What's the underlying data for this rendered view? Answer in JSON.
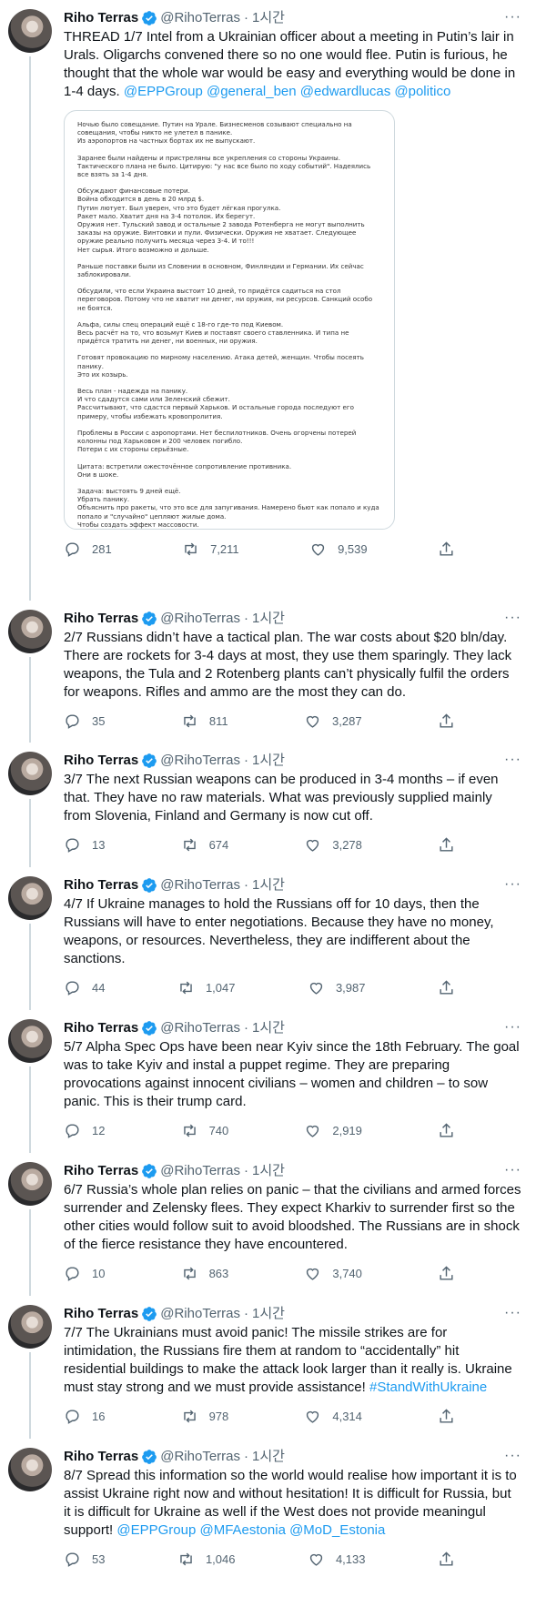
{
  "author": {
    "name": "Riho Terras",
    "handle": "@RihoTerras",
    "time": "1시간"
  },
  "colors": {
    "accent": "#1d9bf0",
    "text": "#0f1419",
    "muted": "#536471",
    "border": "#cfd9de"
  },
  "tweets": [
    {
      "text_parts": [
        "THREAD 1/7 Intel from a Ukrainian officer about a meeting in Putin’s lair in Urals. Oligarchs convened there so no one would flee. Putin is furious, he thought that the whole war would be easy and everything would be done in 1-4 days. "
      ],
      "mentions": "@EPPGroup @general_ben @edwardlucas @politico",
      "replies": "281",
      "retweets": "7,211",
      "likes": "9,539"
    },
    {
      "text": "2/7 Russians didn’t have a tactical plan. The war costs about $20 bln/day. There are rockets for 3-4 days at most, they use them sparingly. They lack weapons, the Tula and 2 Rotenberg plants can’t physically fulfil the orders for weapons. Rifles and ammo are the most they can do.",
      "replies": "35",
      "retweets": "811",
      "likes": "3,287"
    },
    {
      "text": "3/7 The next Russian weapons can be produced in 3-4 months – if even that. They have no raw materials. What was previously supplied mainly from Slovenia, Finland and Germany is now cut off.",
      "replies": "13",
      "retweets": "674",
      "likes": "3,278"
    },
    {
      "text": "4/7 If Ukraine manages to hold the Russians off for 10 days, then the Russians will have to enter negotiations. Because they have no money, weapons, or resources. Nevertheless, they are indifferent about the sanctions.",
      "replies": "44",
      "retweets": "1,047",
      "likes": "3,987"
    },
    {
      "text": "5/7 Alpha Spec Ops have been near Kyiv since the 18th February. The goal was to take Kyiv and instal a puppet regime. They are preparing provocations against innocent civilians – women and children – to sow panic. This is their trump card.",
      "replies": "12",
      "retweets": "740",
      "likes": "2,919"
    },
    {
      "text": "6/7 Russia’s whole plan relies on panic – that the civilians and armed forces surrender and Zelensky flees. They expect Kharkiv to surrender first so the other cities would follow suit to avoid bloodshed. The Russians are in shock of the fierce resistance they have encountered.",
      "replies": "10",
      "retweets": "863",
      "likes": "3,740"
    },
    {
      "text": "7/7 The Ukrainians must avoid panic! The missile strikes are for intimidation, the Russians fire them at random to “accidentally” hit residential buildings to make the attack look larger than it really is. Ukraine must stay strong and we must provide assistance! ",
      "hashtag": "#StandWithUkraine",
      "replies": "16",
      "retweets": "978",
      "likes": "4,314"
    },
    {
      "text": "8/7 Spread this information so the world would realise how important it is to assist Ukraine right now and without hesitation! It is difficult for Russia, but it is difficult for Ukraine as well if the West does not provide meaningul support! ",
      "mentions": "@EPPGroup @MFAestonia @MoD_Estonia",
      "replies": "53",
      "retweets": "1,046",
      "likes": "4,133"
    }
  ],
  "image_text": [
    "Ночью было совещание. Путин на Урале. Бизнесменов созывают специально на совещания, чтобы никто не улетел в панике.",
    "Из аэропортов на частных бортах их не выпускают.",
    "",
    "Заранее были найдены и пристреляны все укрепления со стороны Украины. Тактического плана не было. Цитирую: \"у нас все было по ходу событий\". Надеялись все взять за 1-4 дня.",
    "",
    "Обсуждают финансовые потери.",
    "Война обходится в день в 20 млрд $.",
    "Путин лютует. Был уверен, что это будет лёгкая прогулка.",
    "Ракет мало. Хватит дня на 3-4 потолок. Их берегут.",
    "Оружия нет. Тульский завод и остальные 2 завода Ротенберга не могут выполнить заказы на оружие. Винтовки и пули. Физически. Оружия не хватает. Следующее оружие реально получить месяца через 3-4. И то!!!",
    "Нет сырья. Итого возможно  и дольше.",
    "",
    "Раньше поставки были из Словении в основном, Финляндии и Германии. Их сейчас заблокировали.",
    "",
    "Обсудили, что если Украина выстоит 10 дней, то придётся садиться на стол переговоров. Потому что не хватит ни денег, ни оружия, ни ресурсов. Санкций особо не боятся.",
    "",
    "Альфа, силы спец операций ещё с 18-го где-то под Киевом.",
    "Весь расчёт на то, что возьмут Киев и поставят своего ставленника. И типа не придётся тратить ни денег, ни военных, ни оружия.",
    "",
    "Готовят провокацию по мирному населению. Атака детей, женщин. Чтобы посеять панику.",
    "Это их козырь.",
    "",
    "Весь план - надежда на панику.",
    "И что сдадутся сами или Зеленский  сбежит.",
    "Рассчитывают, что сдастся первый Харьков. И остальные города последуют его примеру, чтобы избежать кровопролития.",
    "",
    "Проблемы в России с аэропортами. Нет беспилотников. Очень огорчены потерей колонны под Харьковом и 200 человек погибло.",
    "Потери с их стороны серьёзные.",
    "",
    "Цитата: встретили ожесточённое сопротивление противника.",
    "Они в шоке.",
    "",
    "Задача: выстоять 9 дней ещё.",
    "Убрать панику.",
    "Объяснить про ракеты, что это все для запугивания. Намерено бьют как попало и куда попало и \"случайно\" цепляют жилые дома.",
    "Чтобы создать эффект массовости."
  ]
}
